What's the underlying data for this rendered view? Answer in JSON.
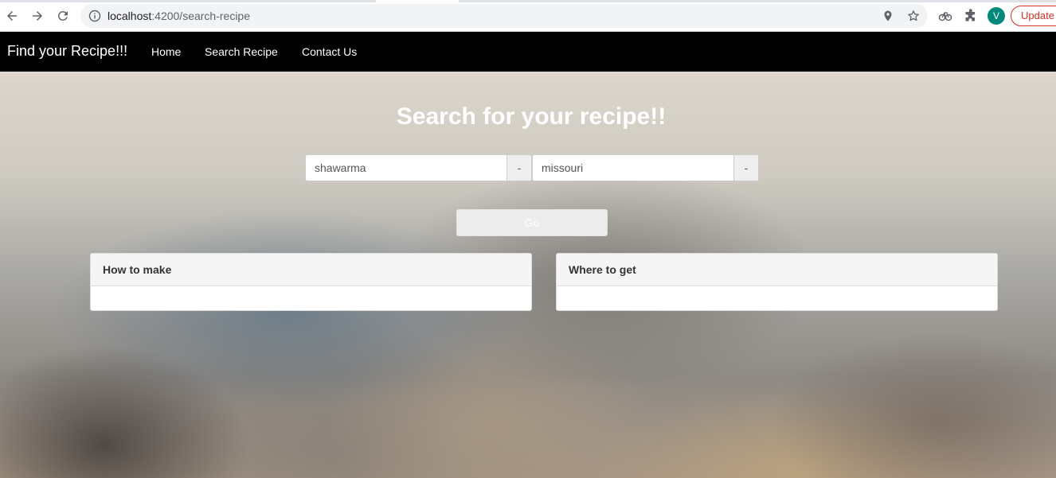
{
  "browser": {
    "url_host": "localhost",
    "url_path": ":4200/search-recipe",
    "profile_initial": "V",
    "update_label": "Update",
    "icons": {
      "back": "arrow-left-icon",
      "forward": "arrow-right-icon",
      "reload": "reload-icon",
      "site_info": "info-icon",
      "location": "location-pin-icon",
      "bookmark": "star-icon",
      "extension_1": "extension-icon",
      "extensions": "puzzle-icon"
    }
  },
  "navbar": {
    "brand": "Find your Recipe!!!",
    "links": [
      "Home",
      "Search Recipe",
      "Contact Us"
    ]
  },
  "search": {
    "title": "Search for your recipe!!",
    "recipe_value": "shawarma",
    "recipe_addon": "-",
    "location_value": "missouri",
    "location_addon": "-",
    "go_label": "Go"
  },
  "panels": [
    {
      "heading": "How to make"
    },
    {
      "heading": "Where to get"
    }
  ],
  "colors": {
    "navbar_bg": "#000000",
    "avatar_bg": "#00897b",
    "update_accent": "#d93025"
  }
}
